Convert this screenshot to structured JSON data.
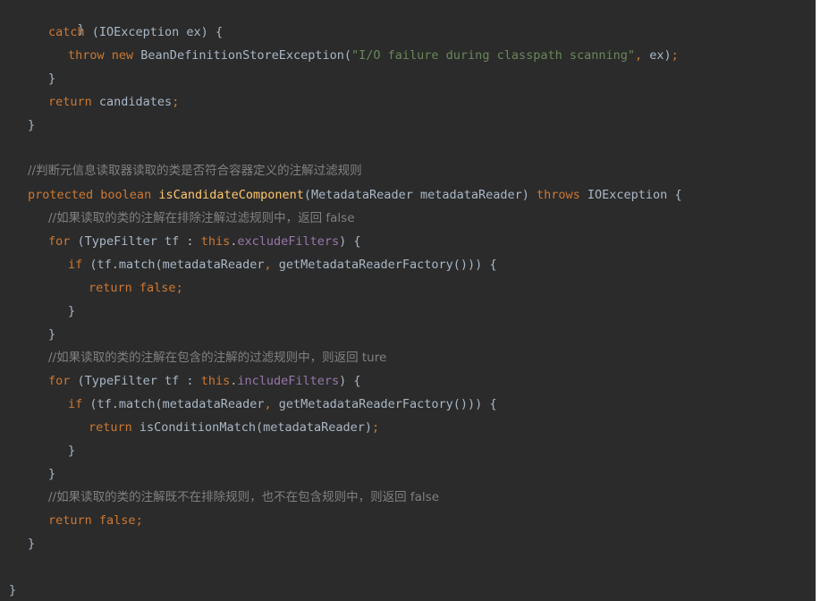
{
  "code": {
    "l01": {
      "close": "}"
    },
    "l02": {
      "catch": "catch",
      "rest": " (IOException ex) {"
    },
    "l03": {
      "throw": "throw",
      "new": "new",
      "mid": " BeanDefinitionStoreException(",
      "str": "\"I/O failure during classpath scanning\"",
      "tail1": ",",
      "tail2": " ex)",
      "semi": ";"
    },
    "l04": {
      "close": "}"
    },
    "l05": {
      "ret": "return",
      "rest": " candidates",
      "semi": ";"
    },
    "l06": {
      "close": "}"
    },
    "l07": {
      "comment": "//判断元信息读取器读取的类是否符合容器定义的注解过滤规则"
    },
    "l08": {
      "protected": "protected",
      "boolean": "boolean",
      "name": "isCandidateComponent",
      "params": "(MetadataReader metadataReader) ",
      "throws": "throws",
      "exc": " IOException {"
    },
    "l09": {
      "comment": "//如果读取的类的注解在排除注解过滤规则中，返回 false"
    },
    "l10": {
      "for": "for",
      "p1": " (TypeFilter tf : ",
      "this": "this",
      "dot": ".",
      "field": "excludeFilters",
      "p2": ") {"
    },
    "l11": {
      "if": "if",
      "p1": " (tf.match(metadataReader",
      "comma": ",",
      "p2": " getMetadataReaderFactory())) {"
    },
    "l12": {
      "ret": "return",
      "val": " false",
      "semi": ";"
    },
    "l13": {
      "close": "}"
    },
    "l14": {
      "close": "}"
    },
    "l15": {
      "comment": "//如果读取的类的注解在包含的注解的过滤规则中，则返回 ture"
    },
    "l16": {
      "for": "for",
      "p1": " (TypeFilter tf : ",
      "this": "this",
      "dot": ".",
      "field": "includeFilters",
      "p2": ") {"
    },
    "l17": {
      "if": "if",
      "p1": " (tf.match(metadataReader",
      "comma": ",",
      "p2": " getMetadataReaderFactory())) {"
    },
    "l18": {
      "ret": "return",
      "rest": " isConditionMatch(metadataReader)",
      "semi": ";"
    },
    "l19": {
      "close": "}"
    },
    "l20": {
      "close": "}"
    },
    "l21": {
      "comment": "//如果读取的类的注解既不在排除规则，也不在包含规则中，则返回 false"
    },
    "l22": {
      "ret": "return",
      "val": " false",
      "semi": ";"
    },
    "l23": {
      "close": "}"
    },
    "l24": {
      "close": "}"
    }
  }
}
